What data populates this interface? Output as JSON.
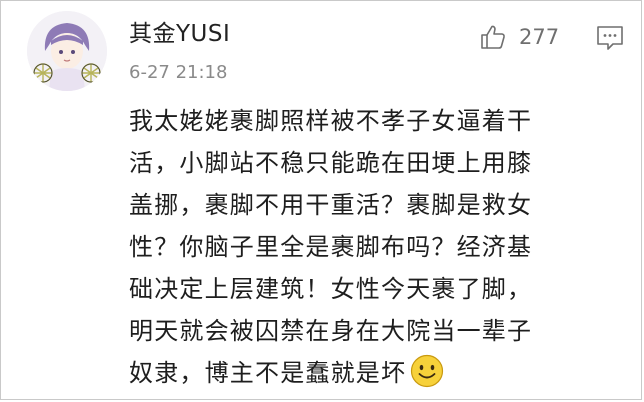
{
  "comment": {
    "username": "其金YUSI",
    "timestamp": "6-27 21:18",
    "like_count": "277",
    "lines": [
      "我太姥姥裹脚照样被不孝子女逼着干",
      "活，小脚站不稳只能跪在田埂上用膝",
      "盖挪，裹脚不用干重活？裹脚是救女",
      "性？你脑子里全是裹脚布吗？经济基",
      "础决定上层建筑！女性今天裹了脚，",
      "明天就会被囚禁在身在大院当一辈子",
      "奴隶，博主不是蠢就是坏"
    ]
  },
  "icons": {
    "avatar": "anime-avatar",
    "like": "thumbs-up-icon",
    "reply": "comment-bubble-icon",
    "emoji": "smile-emoji-icon"
  },
  "colors": {
    "text": "#1e1e1e",
    "meta_gray": "#8a8a8a",
    "icon_gray": "#6f6f6f",
    "emoji_yellow": "#f7d13a",
    "border": "#c9c9c9"
  }
}
